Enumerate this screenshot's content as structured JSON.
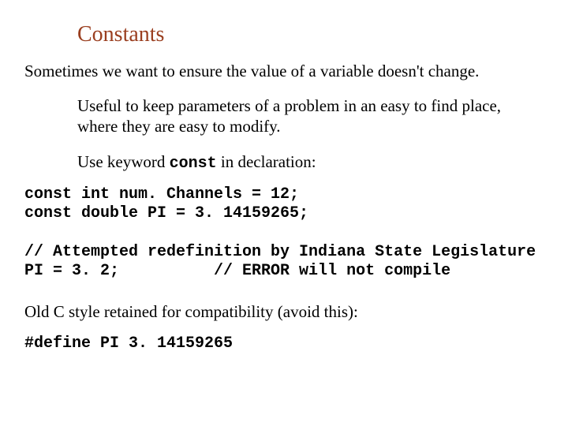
{
  "title": "Constants",
  "para1": "Sometimes we want to ensure the value of a variable doesn't change.",
  "para2": "Useful to keep parameters of a problem in an easy to find place, where they are easy to modify.",
  "para3_pre": "Use keyword ",
  "para3_kw": "const",
  "para3_post": " in declaration:",
  "code1": "const int num. Channels = 12;\nconst double PI = 3. 14159265;",
  "code2": "// Attempted redefinition by Indiana State Legislature\nPI = 3. 2;          // ERROR will not compile",
  "para4": "Old C style retained for compatibility (avoid this):",
  "code3": "#define PI 3. 14159265"
}
